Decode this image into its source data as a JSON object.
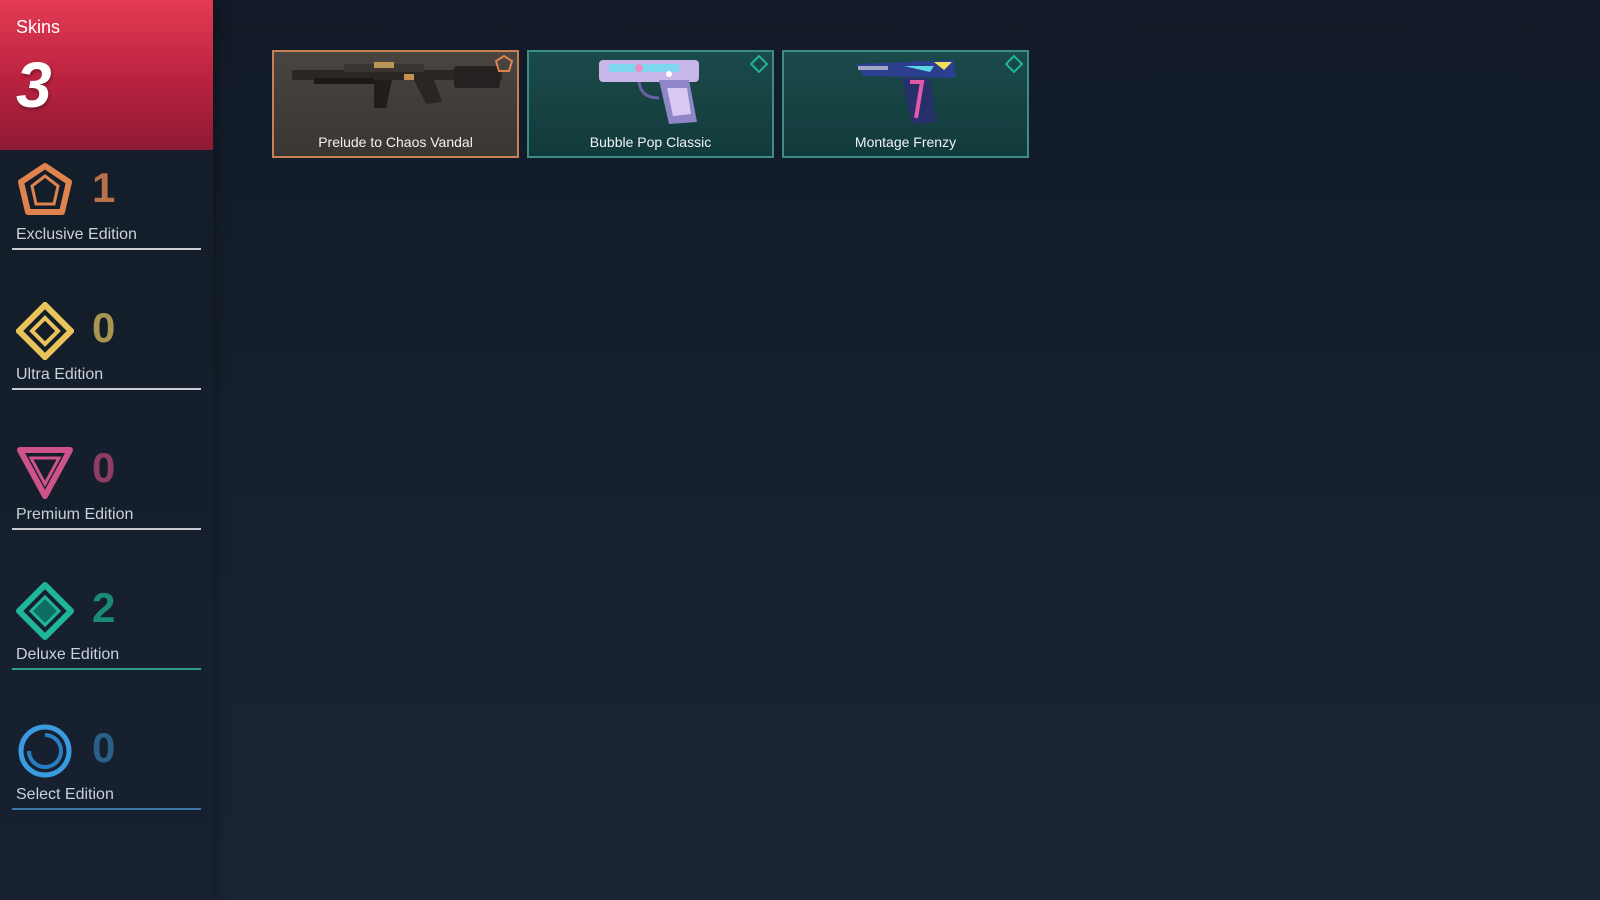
{
  "summary": {
    "label": "Skins",
    "count": "3"
  },
  "tiers": [
    {
      "id": "exclusive",
      "label": "Exclusive Edition",
      "count": "1",
      "color": "#e0844f",
      "icon": "exclusive-edition-icon"
    },
    {
      "id": "ultra",
      "label": "Ultra Edition",
      "count": "0",
      "color": "#e8c45a",
      "icon": "ultra-edition-icon"
    },
    {
      "id": "premium",
      "label": "Premium Edition",
      "count": "0",
      "color": "#d0528a",
      "icon": "premium-edition-icon"
    },
    {
      "id": "deluxe",
      "label": "Deluxe Edition",
      "count": "2",
      "color": "#1fb59a",
      "icon": "deluxe-edition-icon"
    },
    {
      "id": "select",
      "label": "Select Edition",
      "count": "0",
      "color": "#3a9be0",
      "icon": "select-edition-icon"
    }
  ],
  "skins": [
    {
      "name": "Prelude to Chaos Vandal",
      "tier": "exclusive",
      "icon": "rifle-icon"
    },
    {
      "name": "Bubble Pop Classic",
      "tier": "deluxe",
      "icon": "pistol-icon"
    },
    {
      "name": "Montage Frenzy",
      "tier": "deluxe",
      "icon": "pistol-icon"
    }
  ]
}
